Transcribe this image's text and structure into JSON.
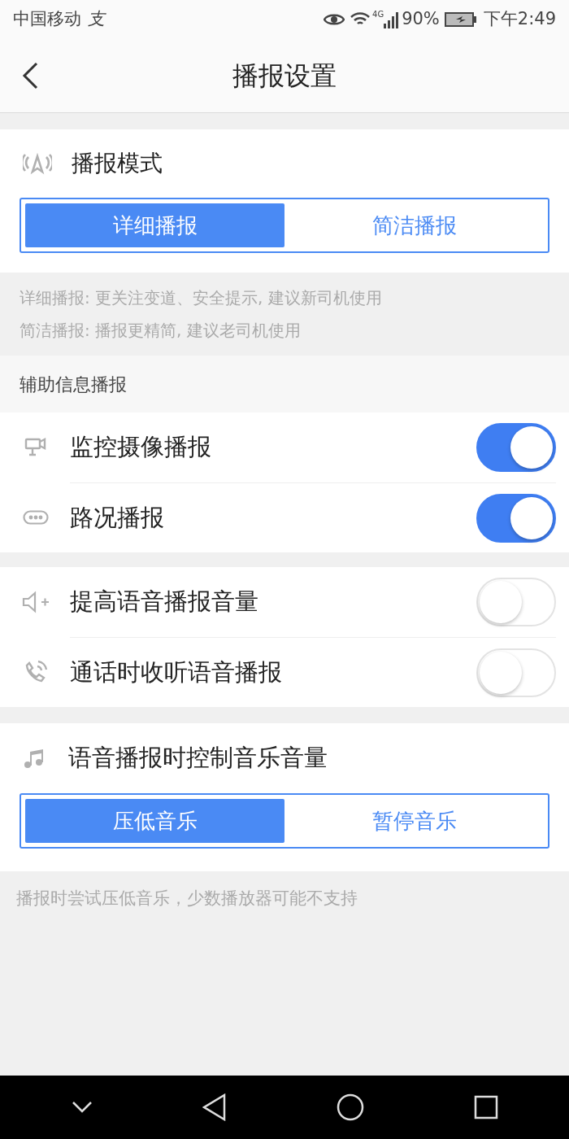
{
  "status_bar": {
    "carrier": "中国移动",
    "notification": "支",
    "network": "4G",
    "battery": "90%",
    "time": "下午2:49"
  },
  "header": {
    "title": "播报设置"
  },
  "mode_section": {
    "title": "播报模式",
    "options": [
      {
        "label": "详细播报",
        "selected": true
      },
      {
        "label": "简洁播报",
        "selected": false
      }
    ]
  },
  "mode_notes": [
    "详细播报: 更关注变道、安全提示, 建议新司机使用",
    "简洁播报: 播报更精简, 建议老司机使用"
  ],
  "aux_header": "辅助信息播报",
  "groups": [
    [
      {
        "label": "监控摄像播报",
        "on": true
      },
      {
        "label": "路况播报",
        "on": true
      }
    ],
    [
      {
        "label": "提高语音播报音量",
        "on": false
      },
      {
        "label": "通话时收听语音播报",
        "on": false
      }
    ]
  ],
  "music_section": {
    "title": "语音播报时控制音乐音量",
    "options": [
      {
        "label": "压低音乐",
        "selected": true
      },
      {
        "label": "暂停音乐",
        "selected": false
      }
    ]
  },
  "music_note": "播报时尝试压低音乐，少数播放器可能不支持"
}
